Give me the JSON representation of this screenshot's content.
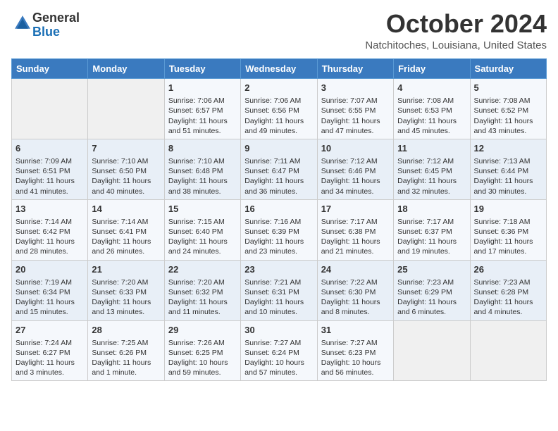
{
  "header": {
    "logo_general": "General",
    "logo_blue": "Blue",
    "month_title": "October 2024",
    "location": "Natchitoches, Louisiana, United States"
  },
  "days_of_week": [
    "Sunday",
    "Monday",
    "Tuesday",
    "Wednesday",
    "Thursday",
    "Friday",
    "Saturday"
  ],
  "weeks": [
    [
      {
        "day": "",
        "info": ""
      },
      {
        "day": "",
        "info": ""
      },
      {
        "day": "1",
        "info": "Sunrise: 7:06 AM\nSunset: 6:57 PM\nDaylight: 11 hours and 51 minutes."
      },
      {
        "day": "2",
        "info": "Sunrise: 7:06 AM\nSunset: 6:56 PM\nDaylight: 11 hours and 49 minutes."
      },
      {
        "day": "3",
        "info": "Sunrise: 7:07 AM\nSunset: 6:55 PM\nDaylight: 11 hours and 47 minutes."
      },
      {
        "day": "4",
        "info": "Sunrise: 7:08 AM\nSunset: 6:53 PM\nDaylight: 11 hours and 45 minutes."
      },
      {
        "day": "5",
        "info": "Sunrise: 7:08 AM\nSunset: 6:52 PM\nDaylight: 11 hours and 43 minutes."
      }
    ],
    [
      {
        "day": "6",
        "info": "Sunrise: 7:09 AM\nSunset: 6:51 PM\nDaylight: 11 hours and 41 minutes."
      },
      {
        "day": "7",
        "info": "Sunrise: 7:10 AM\nSunset: 6:50 PM\nDaylight: 11 hours and 40 minutes."
      },
      {
        "day": "8",
        "info": "Sunrise: 7:10 AM\nSunset: 6:48 PM\nDaylight: 11 hours and 38 minutes."
      },
      {
        "day": "9",
        "info": "Sunrise: 7:11 AM\nSunset: 6:47 PM\nDaylight: 11 hours and 36 minutes."
      },
      {
        "day": "10",
        "info": "Sunrise: 7:12 AM\nSunset: 6:46 PM\nDaylight: 11 hours and 34 minutes."
      },
      {
        "day": "11",
        "info": "Sunrise: 7:12 AM\nSunset: 6:45 PM\nDaylight: 11 hours and 32 minutes."
      },
      {
        "day": "12",
        "info": "Sunrise: 7:13 AM\nSunset: 6:44 PM\nDaylight: 11 hours and 30 minutes."
      }
    ],
    [
      {
        "day": "13",
        "info": "Sunrise: 7:14 AM\nSunset: 6:42 PM\nDaylight: 11 hours and 28 minutes."
      },
      {
        "day": "14",
        "info": "Sunrise: 7:14 AM\nSunset: 6:41 PM\nDaylight: 11 hours and 26 minutes."
      },
      {
        "day": "15",
        "info": "Sunrise: 7:15 AM\nSunset: 6:40 PM\nDaylight: 11 hours and 24 minutes."
      },
      {
        "day": "16",
        "info": "Sunrise: 7:16 AM\nSunset: 6:39 PM\nDaylight: 11 hours and 23 minutes."
      },
      {
        "day": "17",
        "info": "Sunrise: 7:17 AM\nSunset: 6:38 PM\nDaylight: 11 hours and 21 minutes."
      },
      {
        "day": "18",
        "info": "Sunrise: 7:17 AM\nSunset: 6:37 PM\nDaylight: 11 hours and 19 minutes."
      },
      {
        "day": "19",
        "info": "Sunrise: 7:18 AM\nSunset: 6:36 PM\nDaylight: 11 hours and 17 minutes."
      }
    ],
    [
      {
        "day": "20",
        "info": "Sunrise: 7:19 AM\nSunset: 6:34 PM\nDaylight: 11 hours and 15 minutes."
      },
      {
        "day": "21",
        "info": "Sunrise: 7:20 AM\nSunset: 6:33 PM\nDaylight: 11 hours and 13 minutes."
      },
      {
        "day": "22",
        "info": "Sunrise: 7:20 AM\nSunset: 6:32 PM\nDaylight: 11 hours and 11 minutes."
      },
      {
        "day": "23",
        "info": "Sunrise: 7:21 AM\nSunset: 6:31 PM\nDaylight: 11 hours and 10 minutes."
      },
      {
        "day": "24",
        "info": "Sunrise: 7:22 AM\nSunset: 6:30 PM\nDaylight: 11 hours and 8 minutes."
      },
      {
        "day": "25",
        "info": "Sunrise: 7:23 AM\nSunset: 6:29 PM\nDaylight: 11 hours and 6 minutes."
      },
      {
        "day": "26",
        "info": "Sunrise: 7:23 AM\nSunset: 6:28 PM\nDaylight: 11 hours and 4 minutes."
      }
    ],
    [
      {
        "day": "27",
        "info": "Sunrise: 7:24 AM\nSunset: 6:27 PM\nDaylight: 11 hours and 3 minutes."
      },
      {
        "day": "28",
        "info": "Sunrise: 7:25 AM\nSunset: 6:26 PM\nDaylight: 11 hours and 1 minute."
      },
      {
        "day": "29",
        "info": "Sunrise: 7:26 AM\nSunset: 6:25 PM\nDaylight: 10 hours and 59 minutes."
      },
      {
        "day": "30",
        "info": "Sunrise: 7:27 AM\nSunset: 6:24 PM\nDaylight: 10 hours and 57 minutes."
      },
      {
        "day": "31",
        "info": "Sunrise: 7:27 AM\nSunset: 6:23 PM\nDaylight: 10 hours and 56 minutes."
      },
      {
        "day": "",
        "info": ""
      },
      {
        "day": "",
        "info": ""
      }
    ]
  ]
}
